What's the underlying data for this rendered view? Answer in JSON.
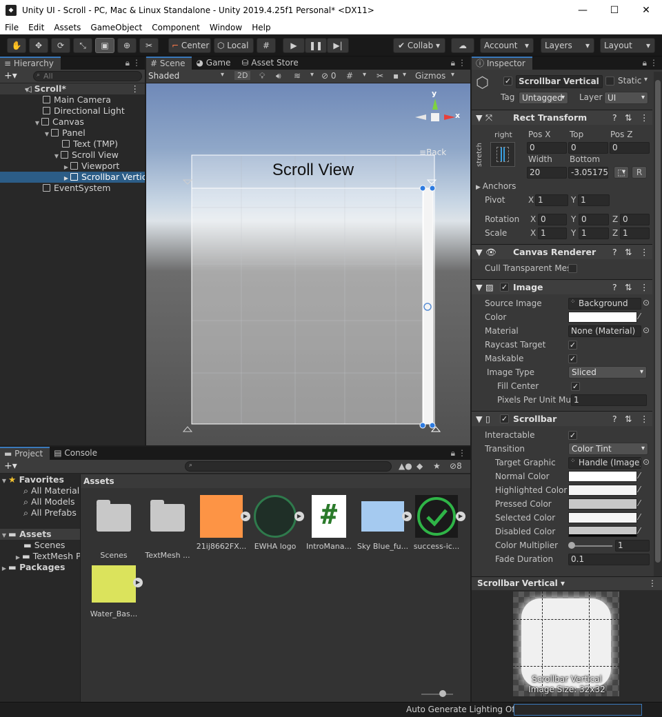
{
  "window": {
    "title": "Unity UI - Scroll - PC, Mac & Linux Standalone - Unity 2019.4.25f1 Personal* <DX11>",
    "buttons": {
      "minimize": "—",
      "maximize": "☐",
      "close": "✕"
    }
  },
  "menu": [
    "File",
    "Edit",
    "Assets",
    "GameObject",
    "Component",
    "Window",
    "Help"
  ],
  "toolbar": {
    "pivot": "Center",
    "space": "Local",
    "collab": "Collab",
    "account": "Account",
    "layers": "Layers",
    "layout": "Layout"
  },
  "hierarchy": {
    "tab": "Hierarchy",
    "search_placeholder": "All",
    "items": [
      {
        "label": "Scroll*",
        "depth": 0
      },
      {
        "label": "Main Camera",
        "depth": 1
      },
      {
        "label": "Directional Light",
        "depth": 1
      },
      {
        "label": "Canvas",
        "depth": 1
      },
      {
        "label": "Panel",
        "depth": 2
      },
      {
        "label": "Text (TMP)",
        "depth": 3
      },
      {
        "label": "Scroll View",
        "depth": 3
      },
      {
        "label": "Viewport",
        "depth": 4
      },
      {
        "label": "Scrollbar Vertic",
        "depth": 4
      },
      {
        "label": "EventSystem",
        "depth": 1
      }
    ]
  },
  "scene": {
    "tabs": [
      "Scene",
      "Game",
      "Asset Store"
    ],
    "shading": "Shaded",
    "mode_2d": "2D",
    "hidden_count": "0",
    "gizmos": "Gizmos",
    "back_label": "Back",
    "axis_y": "y",
    "axis_x": "x",
    "scroll_view_title": "Scroll View"
  },
  "project": {
    "tabs": [
      "Project",
      "Console"
    ],
    "hidden_count": "8",
    "favorites": "Favorites",
    "favorite_items": [
      "All Materials",
      "All Models",
      "All Prefabs"
    ],
    "assets_root": "Assets",
    "asset_folders": [
      "Scenes",
      "TextMesh P"
    ],
    "packages": "Packages",
    "breadcrumb": "Assets",
    "assets": [
      {
        "label": "Scenes",
        "color": "#c8c8c8"
      },
      {
        "label": "TextMesh ...",
        "color": "#c8c8c8"
      },
      {
        "label": "21ij8662FX...",
        "color": "#fd9445"
      },
      {
        "label": "EWHA logo",
        "color": "#1f3a2c"
      },
      {
        "label": "IntroMana...",
        "color": "#ffffff"
      },
      {
        "label": "Sky Blue_fu...",
        "color": "#a5caf0"
      },
      {
        "label": "success-ic...",
        "color": "#2fb447"
      },
      {
        "label": "Water_Bas...",
        "color": "#dbe35c"
      }
    ],
    "script_glyph": "#"
  },
  "inspector": {
    "tab": "Inspector",
    "object_name": "Scrollbar Vertical",
    "static_label": "Static",
    "tag_label": "Tag",
    "tag_value": "Untagged",
    "layer_label": "Layer",
    "layer_value": "UI",
    "rect": {
      "title": "Rect Transform",
      "anchor_h": "right",
      "anchor_v": "stretch",
      "posx_label": "Pos X",
      "posx": "0",
      "top_label": "Top",
      "top": "0",
      "posz_label": "Pos Z",
      "posz": "0",
      "width_label": "Width",
      "width": "20",
      "bottom_label": "Bottom",
      "bottom": "-3.05175",
      "r_button": "R",
      "anchors": "Anchors",
      "pivot_label": "Pivot",
      "pivot_x": "1",
      "pivot_y": "1",
      "rotation_label": "Rotation",
      "rot_x": "0",
      "rot_y": "0",
      "rot_z": "0",
      "scale_label": "Scale",
      "scale_x": "1",
      "scale_y": "1",
      "scale_z": "1",
      "x": "X",
      "y": "Y",
      "z": "Z"
    },
    "canvas_renderer": {
      "title": "Canvas Renderer",
      "cull_label": "Cull Transparent Mes"
    },
    "image": {
      "title": "Image",
      "source_label": "Source Image",
      "source_value": "Background",
      "color_label": "Color",
      "material_label": "Material",
      "material_value": "None (Material)",
      "raycast_label": "Raycast Target",
      "maskable_label": "Maskable",
      "type_label": "Image Type",
      "type_value": "Sliced",
      "fill_label": "Fill Center",
      "ppu_label": "Pixels Per Unit Mul",
      "ppu_value": "1"
    },
    "scrollbar": {
      "title": "Scrollbar",
      "interactable_label": "Interactable",
      "transition_label": "Transition",
      "transition_value": "Color Tint",
      "target_label": "Target Graphic",
      "target_value": "Handle (Image)",
      "normal_label": "Normal Color",
      "highlighted_label": "Highlighted Color",
      "pressed_label": "Pressed Color",
      "selected_label": "Selected Color",
      "disabled_label": "Disabled Color",
      "multiplier_label": "Color Multiplier",
      "multiplier_value": "1",
      "fade_label": "Fade Duration",
      "fade_value": "0.1"
    },
    "preview": {
      "dropdown": "Scrollbar Vertical",
      "name": "Scrollbar Vertical",
      "size": "Image Size: 32x32"
    }
  },
  "status": {
    "text": "Auto Generate Lighting Off"
  },
  "colors": {
    "accent": "#3a79bb",
    "selection": "#2c5d87",
    "normal_color": "#ffffff",
    "highlighted_color": "#f5f5f5",
    "pressed_color": "#c8c8c8",
    "selected_color": "#f5f5f5",
    "disabled_color": "#c8c8c8"
  }
}
